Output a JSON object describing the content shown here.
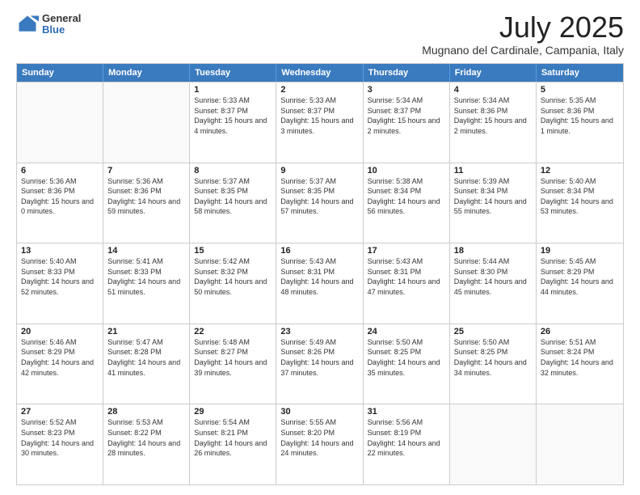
{
  "logo": {
    "general": "General",
    "blue": "Blue"
  },
  "title": "July 2025",
  "location": "Mugnano del Cardinale, Campania, Italy",
  "weekdays": [
    "Sunday",
    "Monday",
    "Tuesday",
    "Wednesday",
    "Thursday",
    "Friday",
    "Saturday"
  ],
  "weeks": [
    [
      {
        "day": "",
        "sunrise": "",
        "sunset": "",
        "daylight": ""
      },
      {
        "day": "",
        "sunrise": "",
        "sunset": "",
        "daylight": ""
      },
      {
        "day": "1",
        "sunrise": "Sunrise: 5:33 AM",
        "sunset": "Sunset: 8:37 PM",
        "daylight": "Daylight: 15 hours and 4 minutes."
      },
      {
        "day": "2",
        "sunrise": "Sunrise: 5:33 AM",
        "sunset": "Sunset: 8:37 PM",
        "daylight": "Daylight: 15 hours and 3 minutes."
      },
      {
        "day": "3",
        "sunrise": "Sunrise: 5:34 AM",
        "sunset": "Sunset: 8:37 PM",
        "daylight": "Daylight: 15 hours and 2 minutes."
      },
      {
        "day": "4",
        "sunrise": "Sunrise: 5:34 AM",
        "sunset": "Sunset: 8:36 PM",
        "daylight": "Daylight: 15 hours and 2 minutes."
      },
      {
        "day": "5",
        "sunrise": "Sunrise: 5:35 AM",
        "sunset": "Sunset: 8:36 PM",
        "daylight": "Daylight: 15 hours and 1 minute."
      }
    ],
    [
      {
        "day": "6",
        "sunrise": "Sunrise: 5:36 AM",
        "sunset": "Sunset: 8:36 PM",
        "daylight": "Daylight: 15 hours and 0 minutes."
      },
      {
        "day": "7",
        "sunrise": "Sunrise: 5:36 AM",
        "sunset": "Sunset: 8:36 PM",
        "daylight": "Daylight: 14 hours and 59 minutes."
      },
      {
        "day": "8",
        "sunrise": "Sunrise: 5:37 AM",
        "sunset": "Sunset: 8:35 PM",
        "daylight": "Daylight: 14 hours and 58 minutes."
      },
      {
        "day": "9",
        "sunrise": "Sunrise: 5:37 AM",
        "sunset": "Sunset: 8:35 PM",
        "daylight": "Daylight: 14 hours and 57 minutes."
      },
      {
        "day": "10",
        "sunrise": "Sunrise: 5:38 AM",
        "sunset": "Sunset: 8:34 PM",
        "daylight": "Daylight: 14 hours and 56 minutes."
      },
      {
        "day": "11",
        "sunrise": "Sunrise: 5:39 AM",
        "sunset": "Sunset: 8:34 PM",
        "daylight": "Daylight: 14 hours and 55 minutes."
      },
      {
        "day": "12",
        "sunrise": "Sunrise: 5:40 AM",
        "sunset": "Sunset: 8:34 PM",
        "daylight": "Daylight: 14 hours and 53 minutes."
      }
    ],
    [
      {
        "day": "13",
        "sunrise": "Sunrise: 5:40 AM",
        "sunset": "Sunset: 8:33 PM",
        "daylight": "Daylight: 14 hours and 52 minutes."
      },
      {
        "day": "14",
        "sunrise": "Sunrise: 5:41 AM",
        "sunset": "Sunset: 8:33 PM",
        "daylight": "Daylight: 14 hours and 51 minutes."
      },
      {
        "day": "15",
        "sunrise": "Sunrise: 5:42 AM",
        "sunset": "Sunset: 8:32 PM",
        "daylight": "Daylight: 14 hours and 50 minutes."
      },
      {
        "day": "16",
        "sunrise": "Sunrise: 5:43 AM",
        "sunset": "Sunset: 8:31 PM",
        "daylight": "Daylight: 14 hours and 48 minutes."
      },
      {
        "day": "17",
        "sunrise": "Sunrise: 5:43 AM",
        "sunset": "Sunset: 8:31 PM",
        "daylight": "Daylight: 14 hours and 47 minutes."
      },
      {
        "day": "18",
        "sunrise": "Sunrise: 5:44 AM",
        "sunset": "Sunset: 8:30 PM",
        "daylight": "Daylight: 14 hours and 45 minutes."
      },
      {
        "day": "19",
        "sunrise": "Sunrise: 5:45 AM",
        "sunset": "Sunset: 8:29 PM",
        "daylight": "Daylight: 14 hours and 44 minutes."
      }
    ],
    [
      {
        "day": "20",
        "sunrise": "Sunrise: 5:46 AM",
        "sunset": "Sunset: 8:29 PM",
        "daylight": "Daylight: 14 hours and 42 minutes."
      },
      {
        "day": "21",
        "sunrise": "Sunrise: 5:47 AM",
        "sunset": "Sunset: 8:28 PM",
        "daylight": "Daylight: 14 hours and 41 minutes."
      },
      {
        "day": "22",
        "sunrise": "Sunrise: 5:48 AM",
        "sunset": "Sunset: 8:27 PM",
        "daylight": "Daylight: 14 hours and 39 minutes."
      },
      {
        "day": "23",
        "sunrise": "Sunrise: 5:49 AM",
        "sunset": "Sunset: 8:26 PM",
        "daylight": "Daylight: 14 hours and 37 minutes."
      },
      {
        "day": "24",
        "sunrise": "Sunrise: 5:50 AM",
        "sunset": "Sunset: 8:25 PM",
        "daylight": "Daylight: 14 hours and 35 minutes."
      },
      {
        "day": "25",
        "sunrise": "Sunrise: 5:50 AM",
        "sunset": "Sunset: 8:25 PM",
        "daylight": "Daylight: 14 hours and 34 minutes."
      },
      {
        "day": "26",
        "sunrise": "Sunrise: 5:51 AM",
        "sunset": "Sunset: 8:24 PM",
        "daylight": "Daylight: 14 hours and 32 minutes."
      }
    ],
    [
      {
        "day": "27",
        "sunrise": "Sunrise: 5:52 AM",
        "sunset": "Sunset: 8:23 PM",
        "daylight": "Daylight: 14 hours and 30 minutes."
      },
      {
        "day": "28",
        "sunrise": "Sunrise: 5:53 AM",
        "sunset": "Sunset: 8:22 PM",
        "daylight": "Daylight: 14 hours and 28 minutes."
      },
      {
        "day": "29",
        "sunrise": "Sunrise: 5:54 AM",
        "sunset": "Sunset: 8:21 PM",
        "daylight": "Daylight: 14 hours and 26 minutes."
      },
      {
        "day": "30",
        "sunrise": "Sunrise: 5:55 AM",
        "sunset": "Sunset: 8:20 PM",
        "daylight": "Daylight: 14 hours and 24 minutes."
      },
      {
        "day": "31",
        "sunrise": "Sunrise: 5:56 AM",
        "sunset": "Sunset: 8:19 PM",
        "daylight": "Daylight: 14 hours and 22 minutes."
      },
      {
        "day": "",
        "sunrise": "",
        "sunset": "",
        "daylight": ""
      },
      {
        "day": "",
        "sunrise": "",
        "sunset": "",
        "daylight": ""
      }
    ]
  ]
}
